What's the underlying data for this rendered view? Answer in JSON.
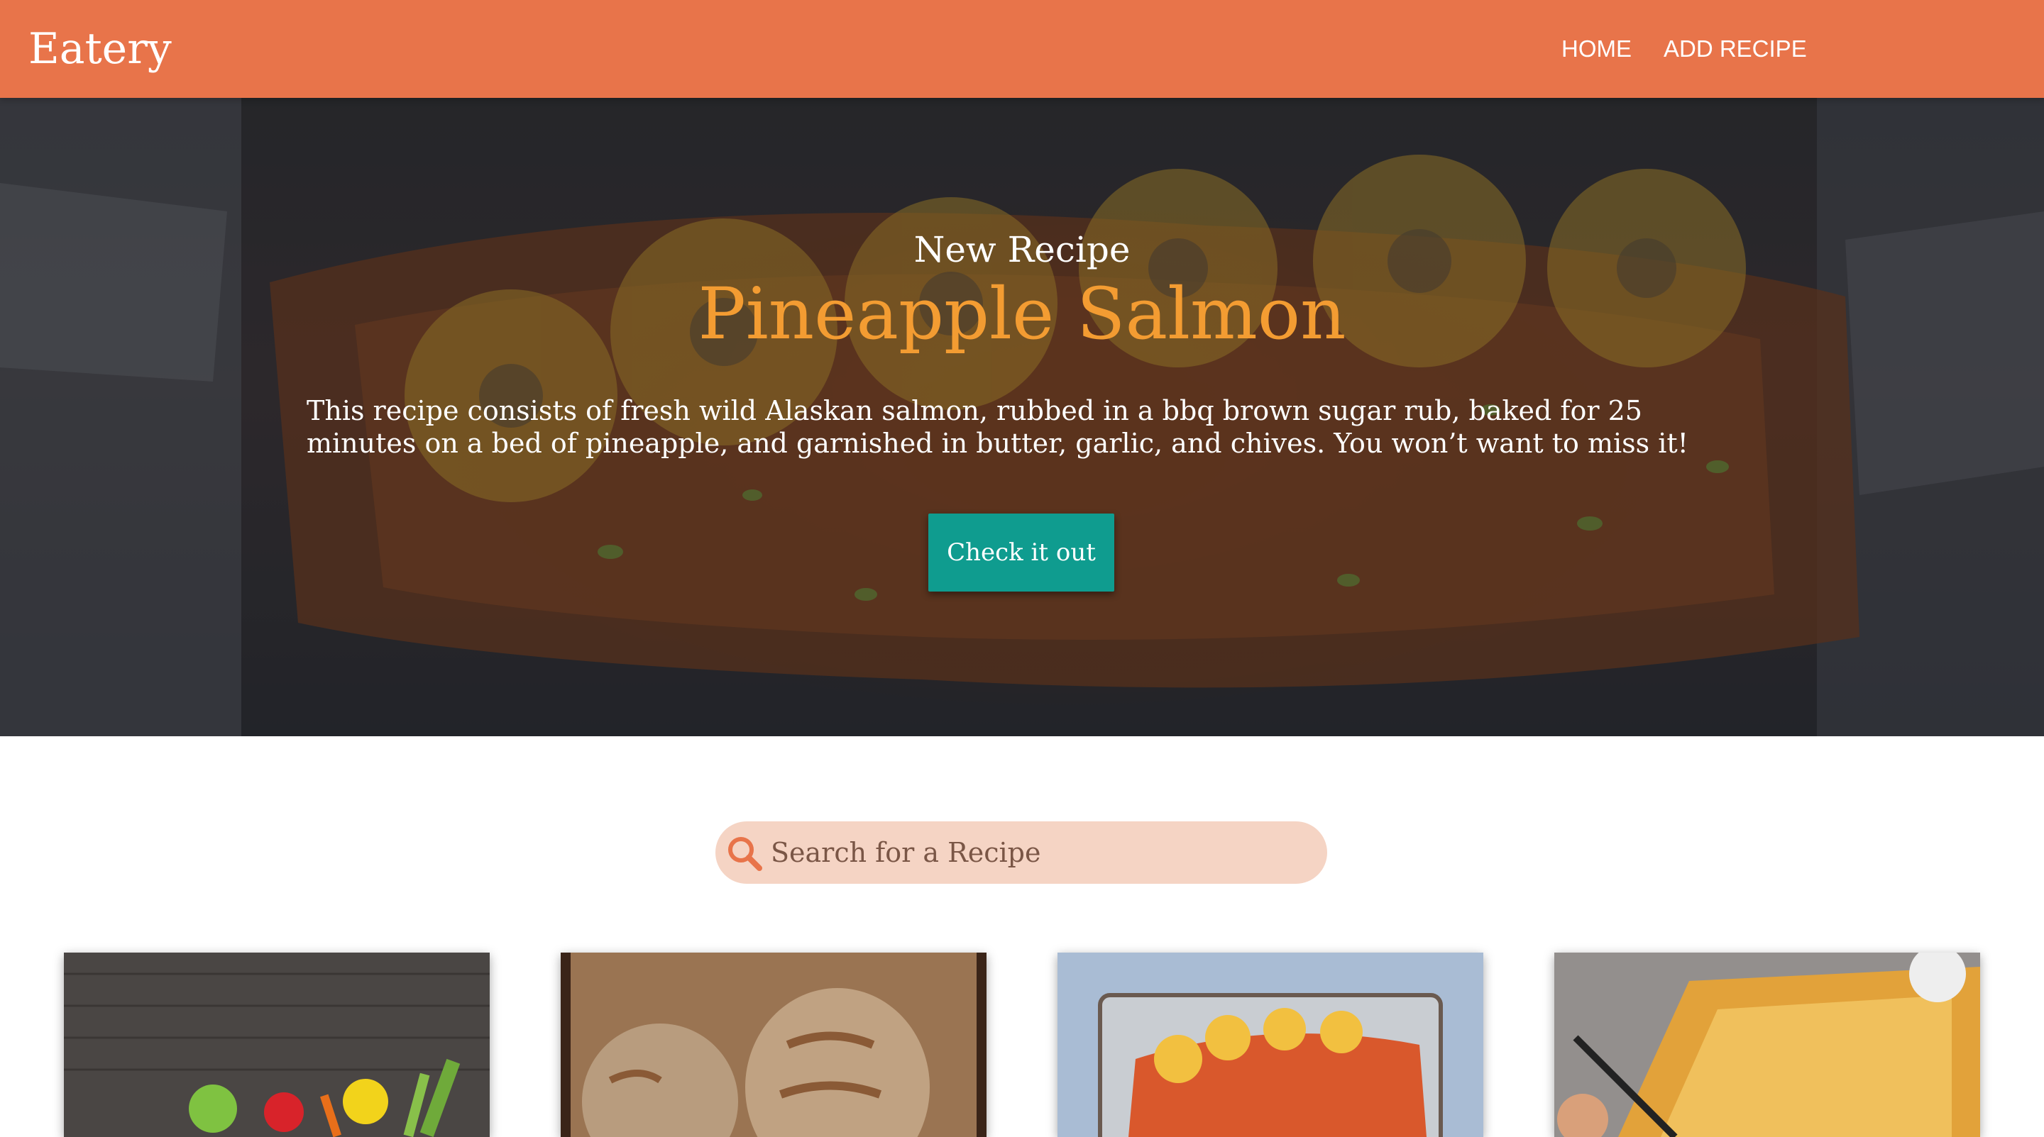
{
  "header": {
    "brand": "Eatery",
    "nav": {
      "home": "HOME",
      "add_recipe": "ADD RECIPE"
    }
  },
  "hero": {
    "kicker": "New Recipe",
    "title": "Pineapple Salmon",
    "description": "This recipe consists of fresh wild Alaskan salmon, rubbed in a bbq brown sugar rub, baked for 25 minutes on a bed of pineapple, and garnished in butter, garlic, and chives. You won’t want to miss it!",
    "button_label": "Check it out"
  },
  "search": {
    "placeholder": "Search for a Recipe",
    "value": ""
  },
  "colors": {
    "header": "#e8744a",
    "title_accent": "#f39c32",
    "button": "#0f9c8f",
    "search_bg": "#f5d4c4"
  },
  "recipe_cards": [
    {
      "image": "vegetables-photo"
    },
    {
      "image": "bread-photo"
    },
    {
      "image": "salmon-photo"
    },
    {
      "image": "dutch-baby-photo"
    }
  ]
}
